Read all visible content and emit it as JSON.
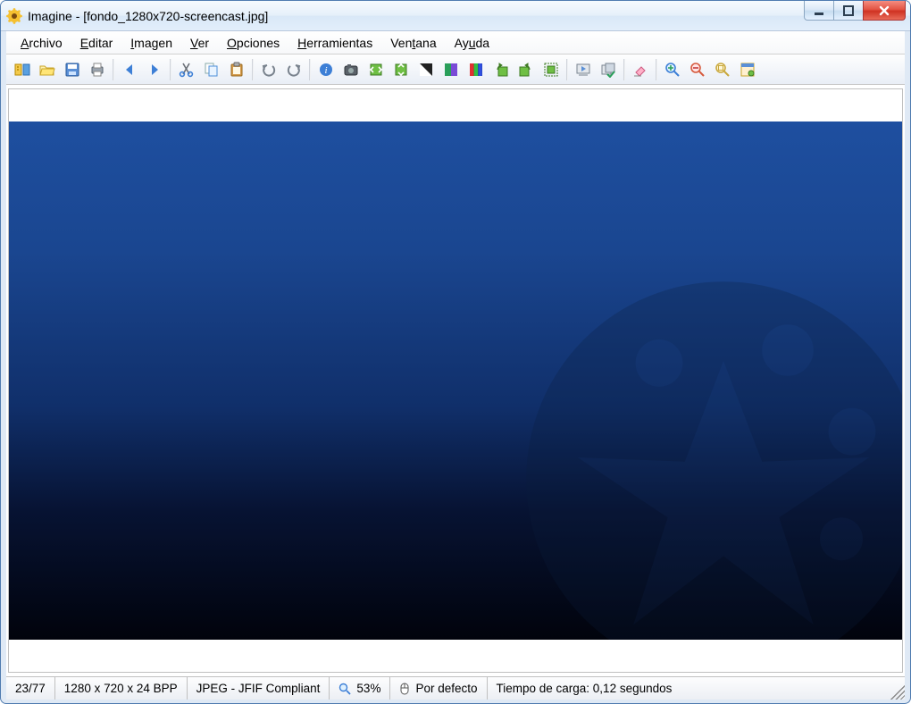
{
  "window": {
    "title": "Imagine - [fondo_1280x720-screencast.jpg]"
  },
  "menu": {
    "archivo": "Archivo",
    "editar": "Editar",
    "imagen": "Imagen",
    "ver": "Ver",
    "opciones": "Opciones",
    "herramientas": "Herramientas",
    "ventana": "Ventana",
    "ayuda": "Ayuda"
  },
  "status": {
    "index": "23/77",
    "dimensions": "1280 x 720 x 24 BPP",
    "format": "JPEG - JFIF Compliant",
    "zoom": "53%",
    "cursor": "Por defecto",
    "loadtime": "Tiempo de carga: 0,12 segundos"
  }
}
